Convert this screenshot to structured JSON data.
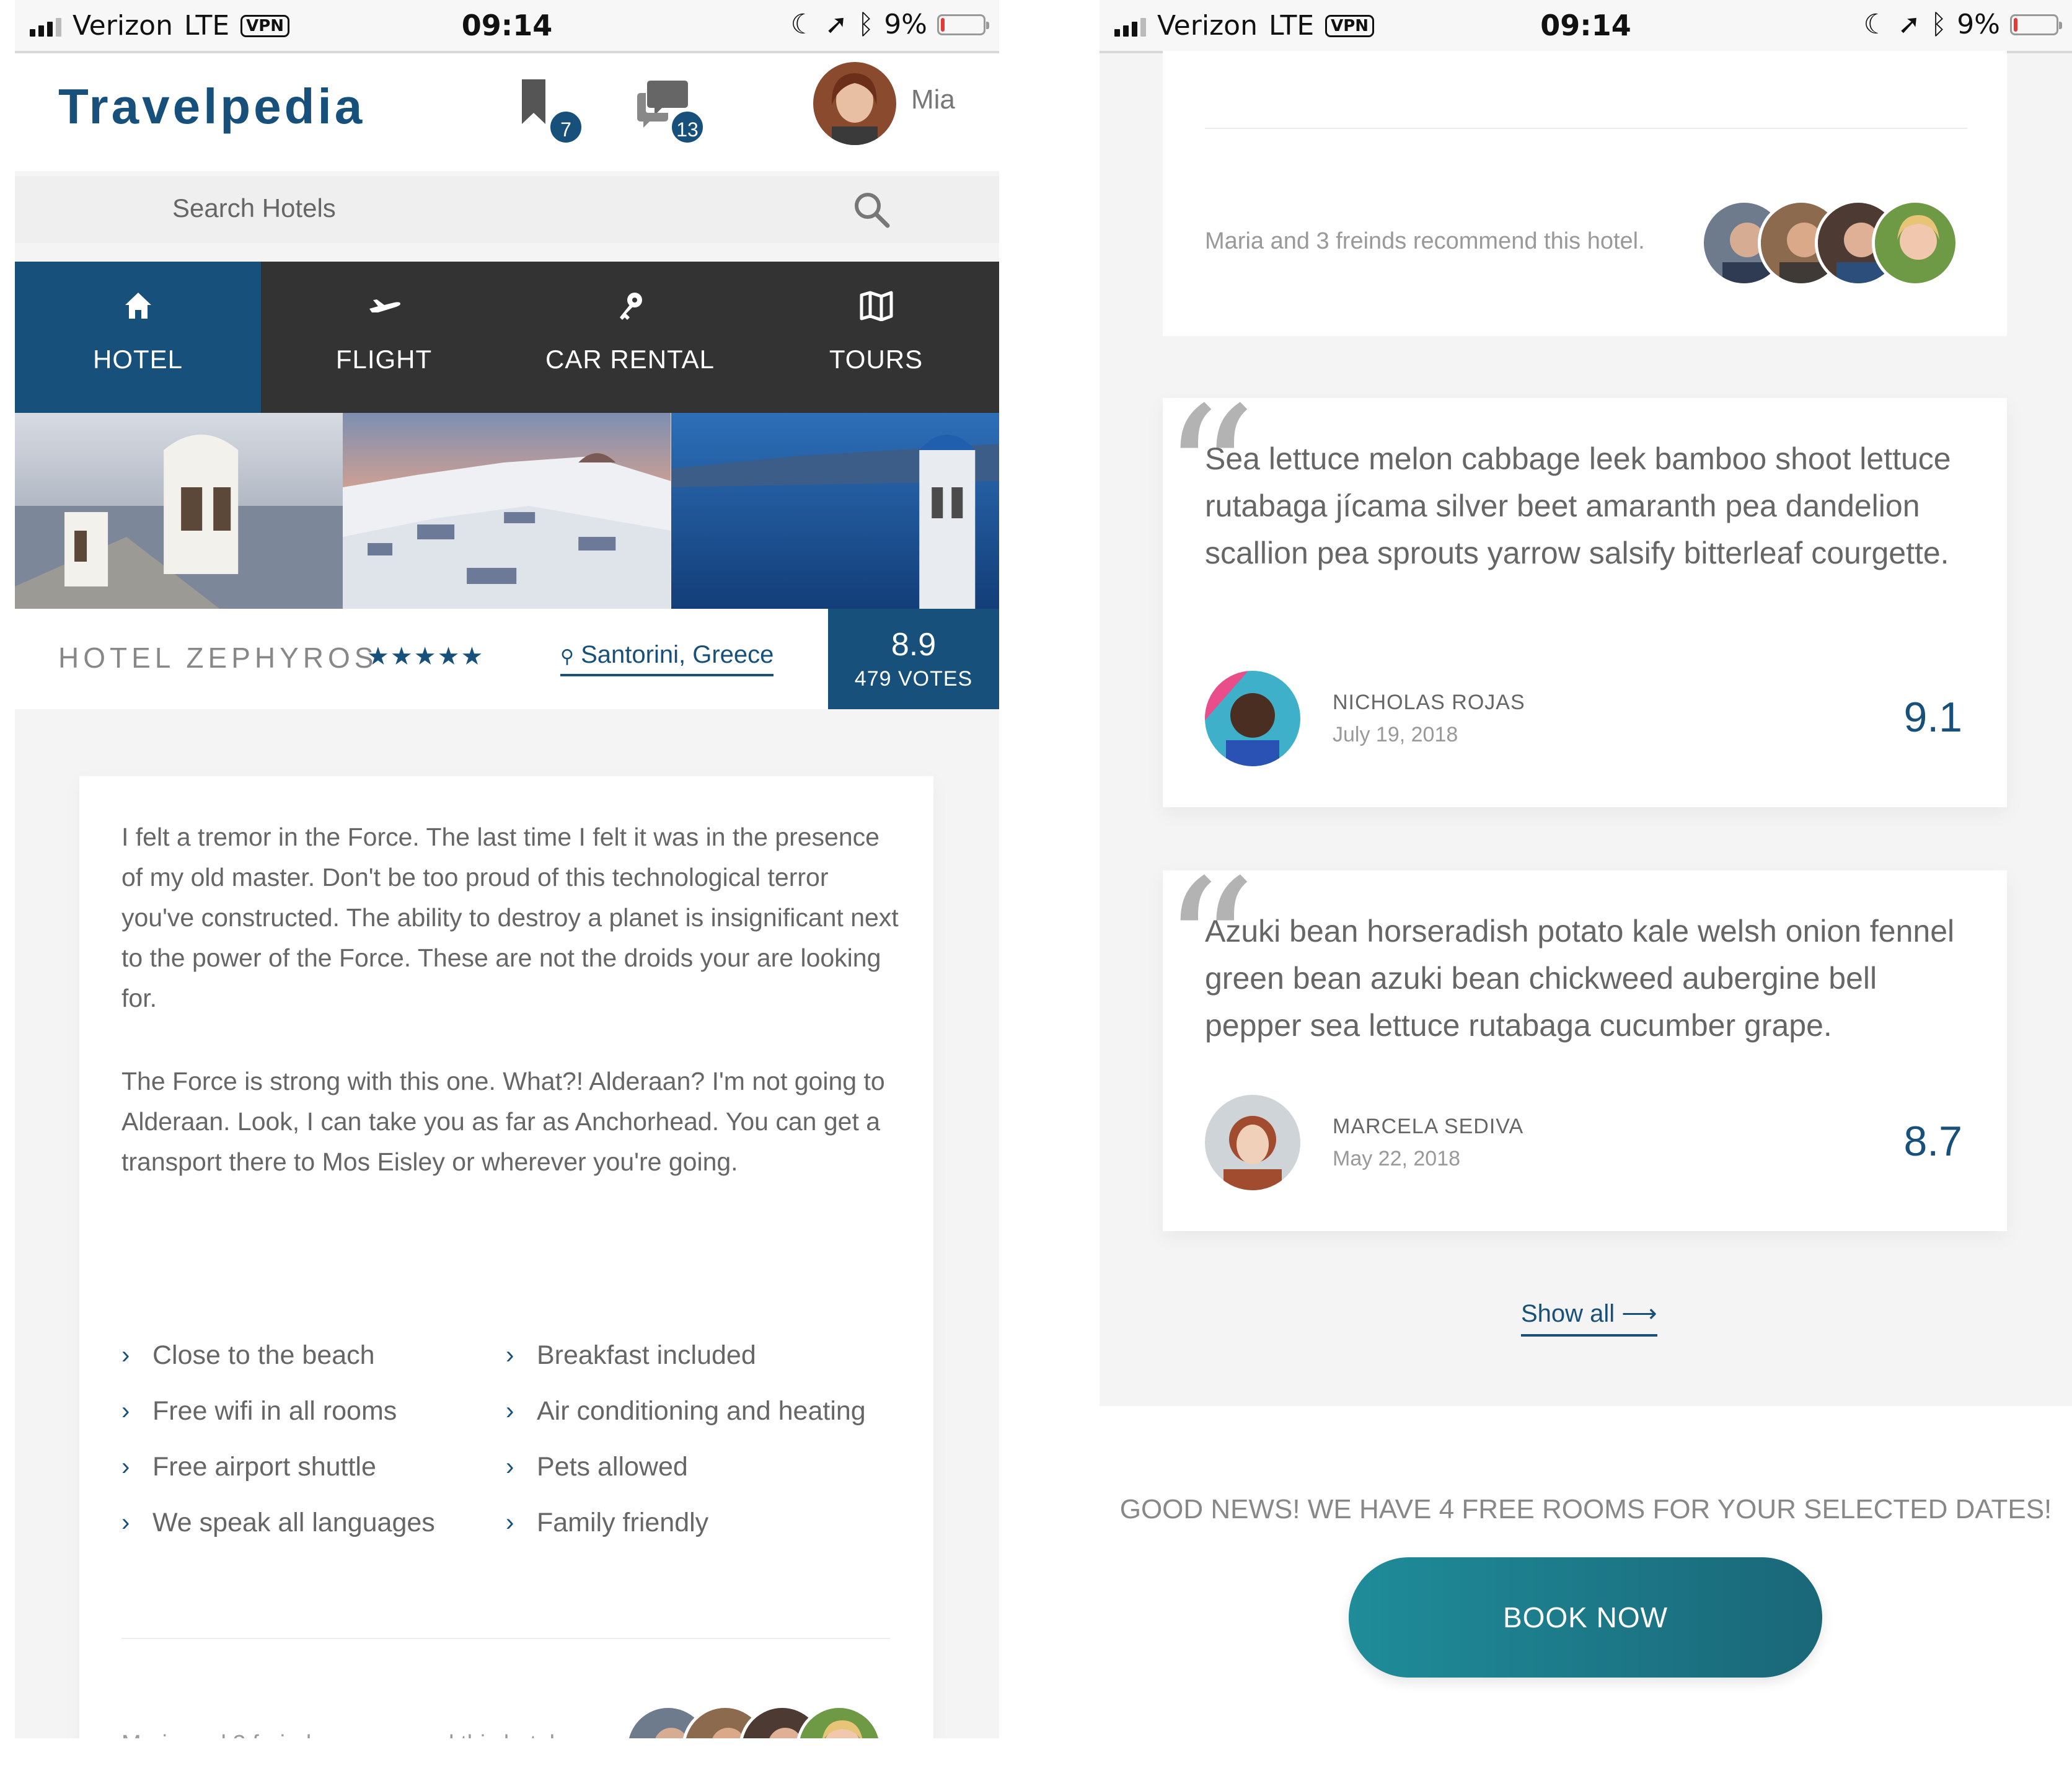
{
  "status_bar": {
    "carrier": "Verizon",
    "network": "LTE",
    "vpn": "VPN",
    "time": "09:14",
    "battery": "9%",
    "battery_level": 0.09
  },
  "header": {
    "logo": "Travelpedia",
    "bookmarks_count": "7",
    "messages_count": "13",
    "user_name": "Mia"
  },
  "search": {
    "placeholder": "Search Hotels"
  },
  "tabs": [
    {
      "label": "HOTEL",
      "icon": "home-icon",
      "active": true
    },
    {
      "label": "FLIGHT",
      "icon": "plane-icon",
      "active": false
    },
    {
      "label": "CAR RENTAL",
      "icon": "key-icon",
      "active": false
    },
    {
      "label": "TOURS",
      "icon": "map-icon",
      "active": false
    }
  ],
  "hotel": {
    "name": "HOTEL ZEPHYROS",
    "stars": "★★★★★",
    "location": "Santorini, Greece",
    "score": "8.9",
    "votes": "479 VOTES"
  },
  "description": {
    "paragraphs": [
      "I felt a tremor in the Force. The last time I felt it was in the presence of my old master. Don't be too proud of this technological terror you've constructed. The ability to destroy a planet is insignificant next to the power of the Force. These are not the droids your are looking for.",
      "The Force is strong with this one. What?! Alderaan? I'm not going to Alderaan. Look, I can take you as far as Anchorhead. You can get a transport there to Mos Eisley or wherever you're going."
    ],
    "features_left": [
      "Close to the beach",
      "Free wifi in all rooms",
      "Free airport shuttle",
      "We speak all languages"
    ],
    "features_right": [
      "Breakfast included",
      "Air conditioning and heating",
      "Pets allowed",
      "Family friendly"
    ],
    "recommend_text": "Maria and 3 freinds recommend this hotel."
  },
  "reviews": [
    {
      "text": "Sea lettuce melon cabbage leek bamboo shoot lettuce rutabaga jícama silver beet amaranth pea dandelion scallion pea sprouts yarrow salsify bitterleaf courgette.",
      "author": "NICHOLAS ROJAS",
      "date": "July 19, 2018",
      "score": "9.1"
    },
    {
      "text": "Azuki bean horseradish potato kale welsh onion fennel green bean azuki bean chickweed aubergine bell pepper sea lettuce rutabaga cucumber grape.",
      "author": "MARCELA SEDIVA",
      "date": "May 22, 2018",
      "score": "8.7"
    }
  ],
  "show_all": "Show all ⟶",
  "booking": {
    "message": "GOOD NEWS! WE HAVE 4 FREE ROOMS FOR YOUR SELECTED DATES!",
    "button": "BOOK NOW"
  },
  "colors": {
    "primary": "#17507a",
    "tab_bar": "#333333",
    "button_gradient_start": "#1f8c99",
    "button_gradient_end": "#1a6778"
  }
}
